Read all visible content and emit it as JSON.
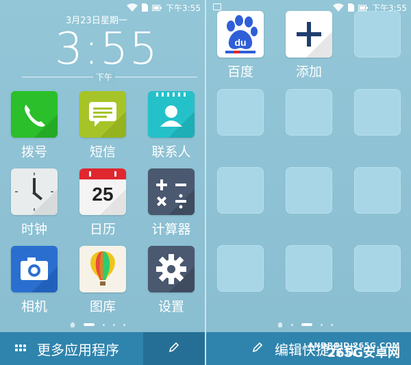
{
  "status_bar": {
    "time": "下午3:55"
  },
  "clock": {
    "date": "3月23日星期一",
    "time": "3:55",
    "ampm": "下午"
  },
  "left_apps": [
    {
      "label": "拨号",
      "icon": "phone-icon"
    },
    {
      "label": "短信",
      "icon": "message-icon"
    },
    {
      "label": "联系人",
      "icon": "contacts-icon"
    },
    {
      "label": "时钟",
      "icon": "clock-icon"
    },
    {
      "label": "日历",
      "icon": "calendar-icon",
      "day": "25"
    },
    {
      "label": "计算器",
      "icon": "calculator-icon"
    },
    {
      "label": "相机",
      "icon": "camera-icon"
    },
    {
      "label": "图库",
      "icon": "gallery-balloon-icon"
    },
    {
      "label": "设置",
      "icon": "gear-icon"
    }
  ],
  "right_apps": [
    {
      "label": "百度",
      "icon": "baidu-paw-icon",
      "badge": "du"
    },
    {
      "label": "添加",
      "icon": "plus-icon"
    }
  ],
  "bottom_bar": {
    "more_apps_label": "更多应用程序",
    "edit_label": "编辑快捷方式"
  },
  "watermark": {
    "line1": "ANDROID.265G.COM",
    "line2": "265G安卓网"
  },
  "colors": {
    "background": "#8fc0d2",
    "bottom_bar": "#2f84ad",
    "empty_slot": "#a8d6e6"
  }
}
